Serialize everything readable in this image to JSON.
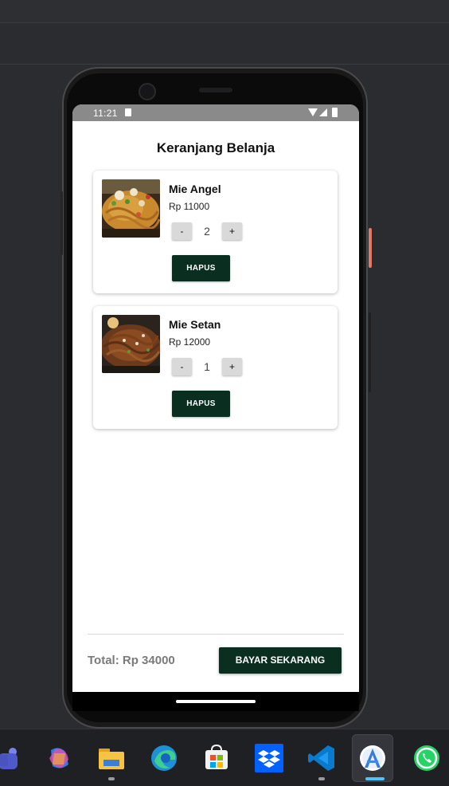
{
  "status_bar": {
    "time": "11:21"
  },
  "screen": {
    "title": "Keranjang Belanja",
    "cart_items": [
      {
        "name": "Mie Angel",
        "price": "Rp 11000",
        "quantity": "2",
        "minus_label": "-",
        "plus_label": "+",
        "remove_label": "HAPUS"
      },
      {
        "name": "Mie Setan",
        "price": "Rp 12000",
        "quantity": "1",
        "minus_label": "-",
        "plus_label": "+",
        "remove_label": "HAPUS"
      }
    ],
    "total": "Total: Rp 34000",
    "pay_button": "BAYAR SEKARANG"
  },
  "taskbar": {
    "apps": [
      "teams-icon",
      "copilot-icon",
      "file-explorer-icon",
      "edge-icon",
      "microsoft-store-icon",
      "dropbox-icon",
      "vscode-icon",
      "android-studio-icon",
      "whatsapp-icon"
    ],
    "active_app": "android-studio-icon"
  },
  "colors": {
    "primary_button": "#0a2e20",
    "accent_side_button": "#e07a66"
  }
}
